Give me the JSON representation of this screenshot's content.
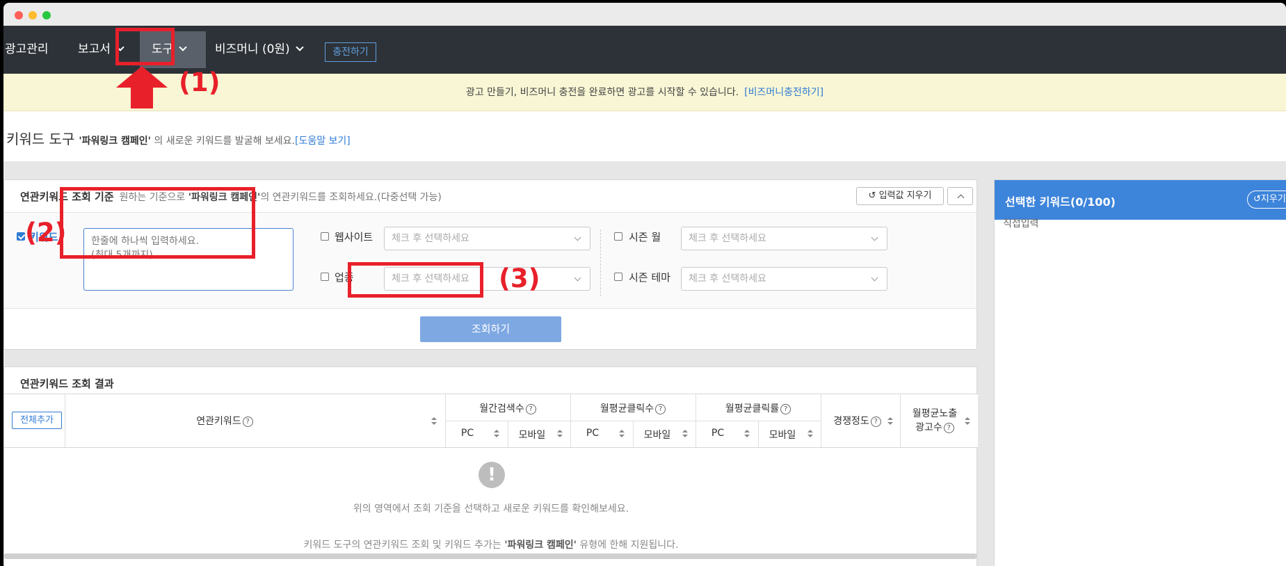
{
  "nav": {
    "ad_manage": "광고관리",
    "report": "보고서",
    "tools": "도구",
    "bizmoney": "비즈머니 (0원)",
    "charge": "충전하기"
  },
  "banner": {
    "message": "광고 만들기, 비즈머니 충전을 완료하면 광고를 시작할 수 있습니다.",
    "link": "[비즈머니충전하기]"
  },
  "tool_header": {
    "title": "키워드 도구",
    "campaign": "'파워링크 캠페인'",
    "desc": " 의 새로운 키워드를 발굴해 보세요.",
    "help": "[도움말 보기]"
  },
  "criteria": {
    "title": "연관키워드 조회 기준",
    "sub_prefix": "원하는 기준으로 ",
    "sub_campaign": "'파워링크 캠페인'",
    "sub_suffix": "의 연관키워드를 조회하세요.(다중선택 가능)",
    "reset": "입력값 지우기",
    "keyword_label": "키워드",
    "keyword_placeholder_1": "한줄에 하나씩 입력하세요.",
    "keyword_placeholder_2": "(최대 5개까지)",
    "website_label": "웹사이트",
    "industry_label": "업종",
    "season_month_label": "시즌 월",
    "season_theme_label": "시즌 테마",
    "select_placeholder": "체크 후 선택하세요",
    "search_button": "조회하기"
  },
  "results": {
    "title": "연관키워드 조회 결과",
    "add_all": "전체추가",
    "col_keyword": "연관키워드",
    "col_monthly_search": "월간검색수",
    "col_monthly_clicks": "월평균클릭수",
    "col_monthly_ctr": "월평균클릭률",
    "col_competition": "경쟁정도",
    "col_impressions_1": "월평균노출",
    "col_impressions_2": "광고수",
    "pc": "PC",
    "mobile": "모바일",
    "empty_message": "위의 영역에서 조회 기준을 선택하고 새로운 키워드를 확인해보세요.",
    "note_prefix": "키워드 도구의 연관키워드 조회 및 키워드 추가는 ",
    "note_campaign": "'파워링크 캠페인'",
    "note_suffix": " 유형에 한해 지원됩니다."
  },
  "side": {
    "title": "선택한 키워드(0/100)",
    "clear": "지우기",
    "direct_input": "직접입력"
  },
  "annotations": {
    "n1": "(1)",
    "n2": "(2)",
    "n3": "(3)"
  },
  "colors": {
    "nav_bg": "#2d3238",
    "accent": "#2f7bd4",
    "annotation": "#e8202a"
  }
}
